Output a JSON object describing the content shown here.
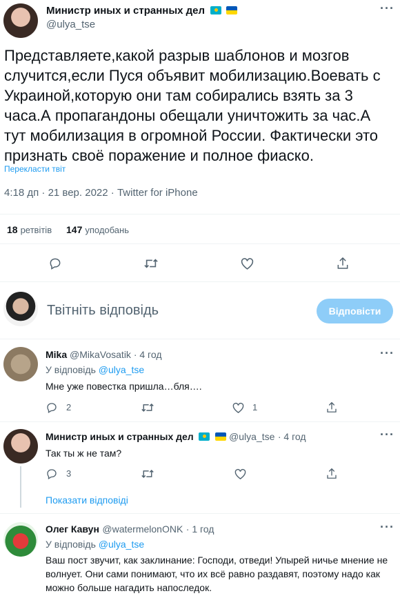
{
  "tweet": {
    "author_name": "Министр иных и странных дел",
    "author_handle": "@ulya_tse",
    "text": "Представляете,какой разрыв шаблонов и мозгов случится,если Пуся объявит мобилизацию.Воевать с Украиной,которую они там собирались взять за 3 часа.А пропагандоны обещали уничтожить за час.А тут мобилизация в огромной России. Фактически это признать своё поражение и полное фиаско.",
    "translate": "Перекласти твіт",
    "timestamp": "4:18 дп · 21 вер. 2022 · Twitter for iPhone",
    "retweets_count": "18",
    "retweets_label": "ретвітів",
    "likes_count": "147",
    "likes_label": "уподобань"
  },
  "compose": {
    "placeholder": "Твітніть відповідь",
    "button": "Відповісти"
  },
  "replies": [
    {
      "name": "Mika",
      "handle": "@MikaVosatik",
      "time": "· 4 год",
      "reply_to_label": "У відповідь",
      "reply_to": "@ulya_tse",
      "text": "Мне уже повестка пришла…бля….",
      "replies": "2",
      "likes": "1"
    },
    {
      "name": "Министр иных и странных дел",
      "handle": "@ulya_tse",
      "time": "· 4 год",
      "text": "Так ты ж не там?",
      "replies": "3",
      "show_replies": "Показати відповіді"
    },
    {
      "name": "Олег Кавун",
      "handle": "@watermelonONK",
      "time": "· 1 год",
      "reply_to_label": "У відповідь",
      "reply_to": "@ulya_tse",
      "text": "Ваш пост звучит, как заклинание: Господи, отведи! Упырей ничье мнение не волнует. Они сами понимают, что их всё равно раздавят, поэтому надо как можно больше нагадить напоследок."
    }
  ],
  "icons": {
    "more": "more-icon",
    "reply": "reply-icon",
    "retweet": "retweet-icon",
    "like": "like-icon",
    "share": "share-icon"
  },
  "colors": {
    "accent": "#1d9bf0",
    "reply_button": "#8ecdf8",
    "secondary_text": "#536471"
  }
}
